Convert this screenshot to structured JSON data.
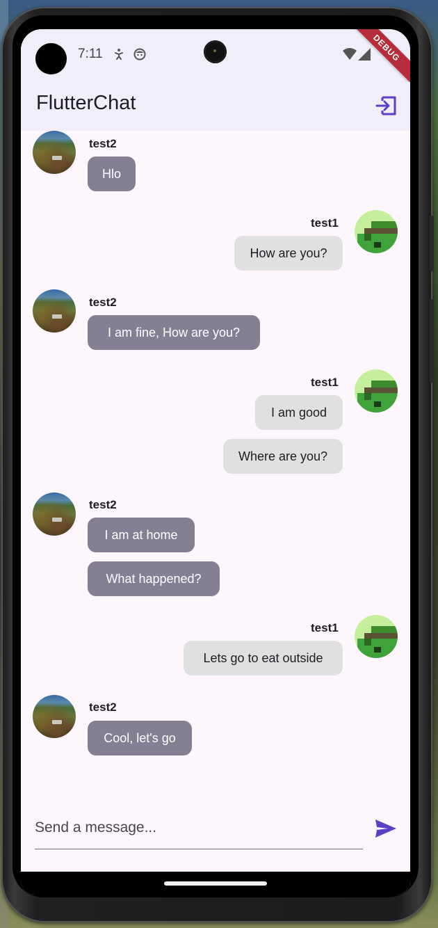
{
  "status_bar": {
    "time": "7:11",
    "icons": [
      "accessibility-icon",
      "face-icon",
      "wifi-icon",
      "signal-icon"
    ],
    "debug_label": "DEBUG"
  },
  "app_bar": {
    "title": "FlutterChat",
    "logout_icon": "logout-icon",
    "accent_color": "#5b3fc4"
  },
  "messages": [
    {
      "sender": "test2",
      "side": "left",
      "show_header": true,
      "text": "Hlo"
    },
    {
      "sender": "test1",
      "side": "right",
      "show_header": true,
      "text": "How are you?"
    },
    {
      "sender": "test2",
      "side": "left",
      "show_header": true,
      "text": "I am fine, How are you?"
    },
    {
      "sender": "test1",
      "side": "right",
      "show_header": true,
      "text": "I am good"
    },
    {
      "sender": "test1",
      "side": "right",
      "show_header": false,
      "text": "Where are you?"
    },
    {
      "sender": "test2",
      "side": "left",
      "show_header": true,
      "text": "I am at home"
    },
    {
      "sender": "test2",
      "side": "left",
      "show_header": false,
      "text": "What happened?"
    },
    {
      "sender": "test1",
      "side": "right",
      "show_header": true,
      "text": "Lets go to eat outside"
    },
    {
      "sender": "test2",
      "side": "left",
      "show_header": true,
      "text": "Cool, let's go"
    }
  ],
  "composer": {
    "placeholder": "Send a message...",
    "value": "",
    "send_icon": "send-icon"
  },
  "colors": {
    "other_bubble": "#847f92",
    "my_bubble": "#e0e0e0",
    "app_bar_bg": "#f1edf9",
    "screen_bg": "#fdf7fd",
    "debug_ribbon": "#b52d3a"
  }
}
